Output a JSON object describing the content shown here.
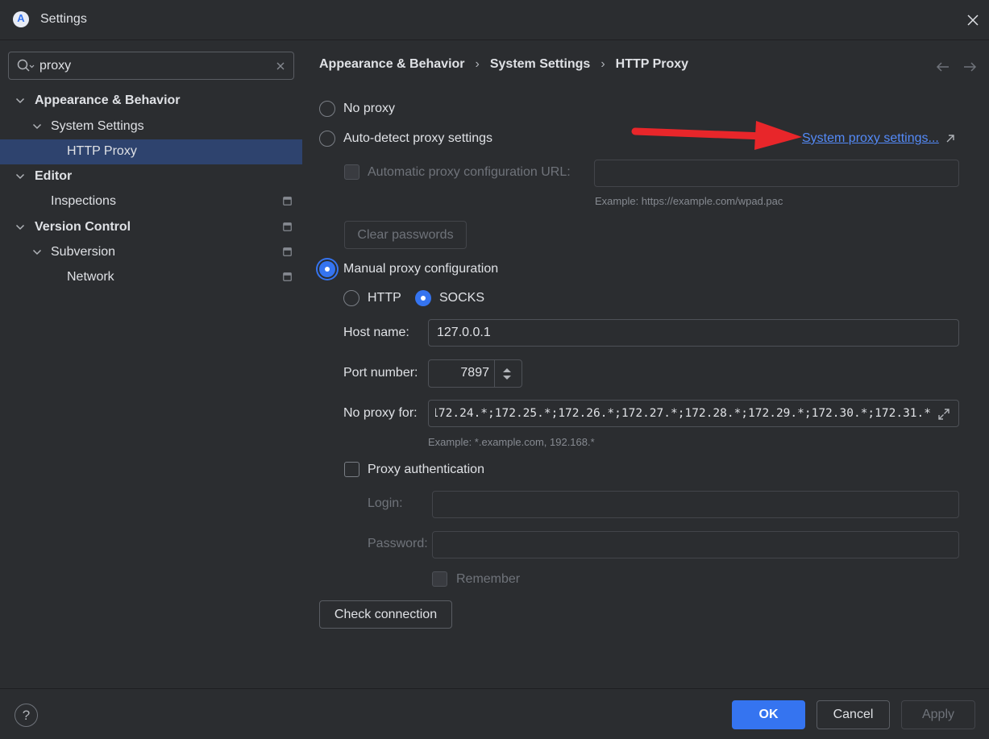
{
  "window": {
    "title": "Settings",
    "logo_letter": "A"
  },
  "search": {
    "value": "proxy",
    "placeholder": ""
  },
  "tree": {
    "appearance_behavior": "Appearance & Behavior",
    "system_settings": "System Settings",
    "http_proxy": "HTTP Proxy",
    "editor": "Editor",
    "inspections": "Inspections",
    "version_control": "Version Control",
    "subversion": "Subversion",
    "network": "Network"
  },
  "breadcrumb": [
    "Appearance & Behavior",
    "System Settings",
    "HTTP Proxy"
  ],
  "breadcrumb_separator": "›",
  "proxy": {
    "no_proxy": "No proxy",
    "auto_detect": "Auto-detect proxy settings",
    "system_proxy_link": "System proxy settings...",
    "auto_config_url_label": "Automatic proxy configuration URL:",
    "auto_config_url_value": "",
    "auto_config_example": "Example: https://example.com/wpad.pac",
    "clear_passwords": "Clear passwords",
    "manual": "Manual proxy configuration",
    "type_http": "HTTP",
    "type_socks": "SOCKS",
    "selected_mode": "manual",
    "selected_type": "SOCKS",
    "host_label": "Host name:",
    "host_value": "127.0.0.1",
    "port_label": "Port number:",
    "port_value": "7897",
    "no_proxy_label": "No proxy for:",
    "no_proxy_value": "172.24.*;172.25.*;172.26.*;172.27.*;172.28.*;172.29.*;172.30.*;172.31.*",
    "no_proxy_example": "Example: *.example.com, 192.168.*",
    "auth_label": "Proxy authentication",
    "login_label": "Login:",
    "login_value": "",
    "password_label": "Password:",
    "password_value": "",
    "remember_label": "Remember",
    "check_connection": "Check connection"
  },
  "footer": {
    "help": "?",
    "ok": "OK",
    "cancel": "Cancel",
    "apply": "Apply"
  },
  "colors": {
    "accent": "#3574f0",
    "link": "#548af7",
    "selection": "#2e436e",
    "annotation_arrow": "#e8262a"
  },
  "icons": [
    "app-logo-icon",
    "close-icon",
    "search-icon",
    "clear-icon",
    "chevron-down-icon",
    "project-scope-icon",
    "back-arrow-icon",
    "forward-arrow-icon",
    "external-link-icon",
    "expand-icon",
    "spinner-icon",
    "help-icon"
  ]
}
